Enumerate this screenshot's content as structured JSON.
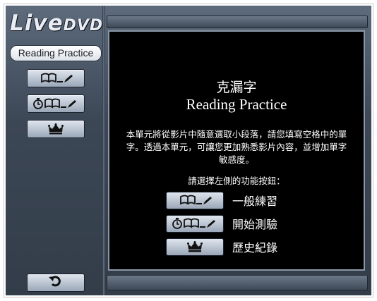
{
  "app": {
    "logo_main": "Live",
    "logo_sub": "DVD",
    "mode_title": "Reading Practice"
  },
  "content": {
    "title_cn": "克漏字",
    "title_en": "Reading Practice",
    "description": "本單元將從影片中隨意選取小段落，請您填寫空格中的單字。透過本單元，可讓您更加熟悉影片內容，並增加單字敏感度。",
    "prompt": "請選擇左側的功能按鈕：",
    "options": [
      {
        "label": "一般練習",
        "icon": "book-pencil-icon"
      },
      {
        "label": "開始測驗",
        "icon": "timer-book-pencil-icon"
      },
      {
        "label": "歷史紀錄",
        "icon": "crown-icon"
      }
    ]
  },
  "sidebar": {
    "buttons": [
      {
        "icon": "book-pencil-icon"
      },
      {
        "icon": "timer-book-pencil-icon"
      },
      {
        "icon": "crown-icon"
      }
    ],
    "back_icon": "refresh-back-icon"
  }
}
